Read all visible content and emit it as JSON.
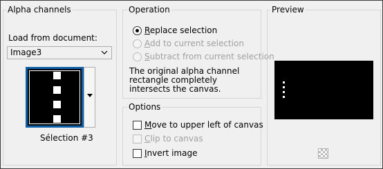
{
  "alpha_channels": {
    "title": "Alpha channels",
    "load_from_label": "Load from document:",
    "document_value": "Image3",
    "selection_name": "Sélection #3"
  },
  "operation": {
    "title": "Operation",
    "options": [
      {
        "label": "Replace selection",
        "selected": true,
        "enabled": true
      },
      {
        "label": "Add to current selection",
        "selected": false,
        "enabled": false
      },
      {
        "label": "Subtract from current selection",
        "selected": false,
        "enabled": false
      }
    ],
    "description": "The original alpha channel rectangle completely intersects the canvas."
  },
  "options_group": {
    "title": "Options",
    "items": [
      {
        "label": "Move to upper left of canvas",
        "checked": false,
        "enabled": true
      },
      {
        "label": "Clip to canvas",
        "checked": false,
        "enabled": false
      },
      {
        "label": "Invert image",
        "checked": false,
        "enabled": true
      }
    ]
  },
  "preview": {
    "title": "Preview"
  },
  "colors": {
    "thumb_border": "#0e5ea8",
    "disabled_text": "#a0a0a0"
  }
}
